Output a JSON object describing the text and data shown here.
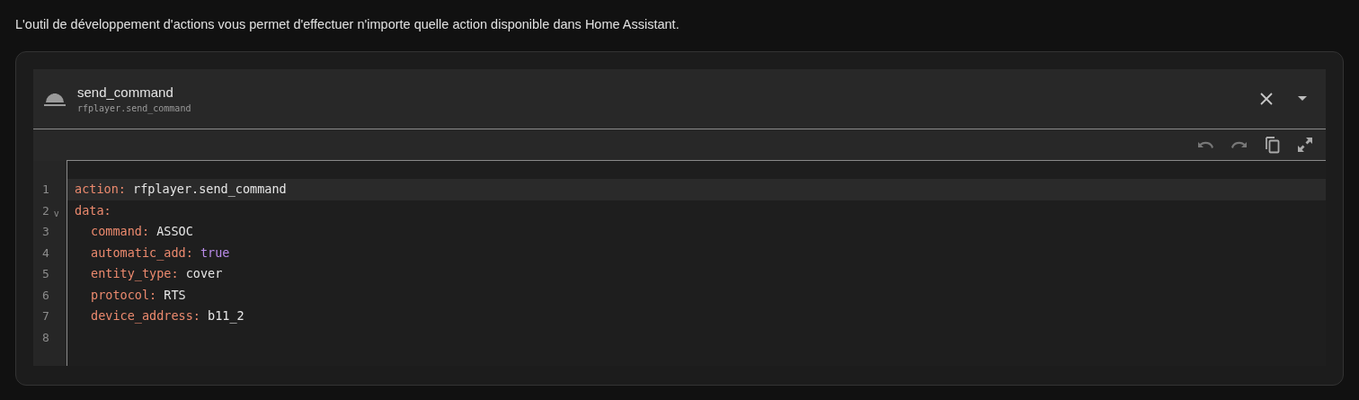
{
  "description": "L'outil de développement d'actions vous permet d'effectuer n'importe quelle action disponible dans Home Assistant.",
  "action": {
    "name": "send_command",
    "id": "rfplayer.send_command"
  },
  "editor": {
    "lines": [
      {
        "number": "1",
        "key": "action:",
        "value": "rfplayer.send_command",
        "color": "#e6e6e6",
        "active": true
      },
      {
        "number": "2",
        "fold": "v",
        "key": "data:",
        "active": false,
        "children": [
          {
            "number": "3",
            "key": "command:",
            "value": "ASSOC",
            "color": "#e6e6e6",
            "active": false
          },
          {
            "number": "4",
            "key": "automatic_add:",
            "value": "true",
            "color": "#b98be8",
            "active": false
          },
          {
            "number": "5",
            "key": "entity_type:",
            "value": "cover",
            "color": "#e6e6e6",
            "active": false
          },
          {
            "number": "6",
            "key": "protocol:",
            "value": "RTS",
            "color": "#e6e6e6",
            "active": false
          },
          {
            "number": "7",
            "key": "device_address:",
            "value": "b11_2",
            "color": "#e6e6e6",
            "active": false
          }
        ]
      },
      {
        "number": "8",
        "active": false
      }
    ]
  }
}
